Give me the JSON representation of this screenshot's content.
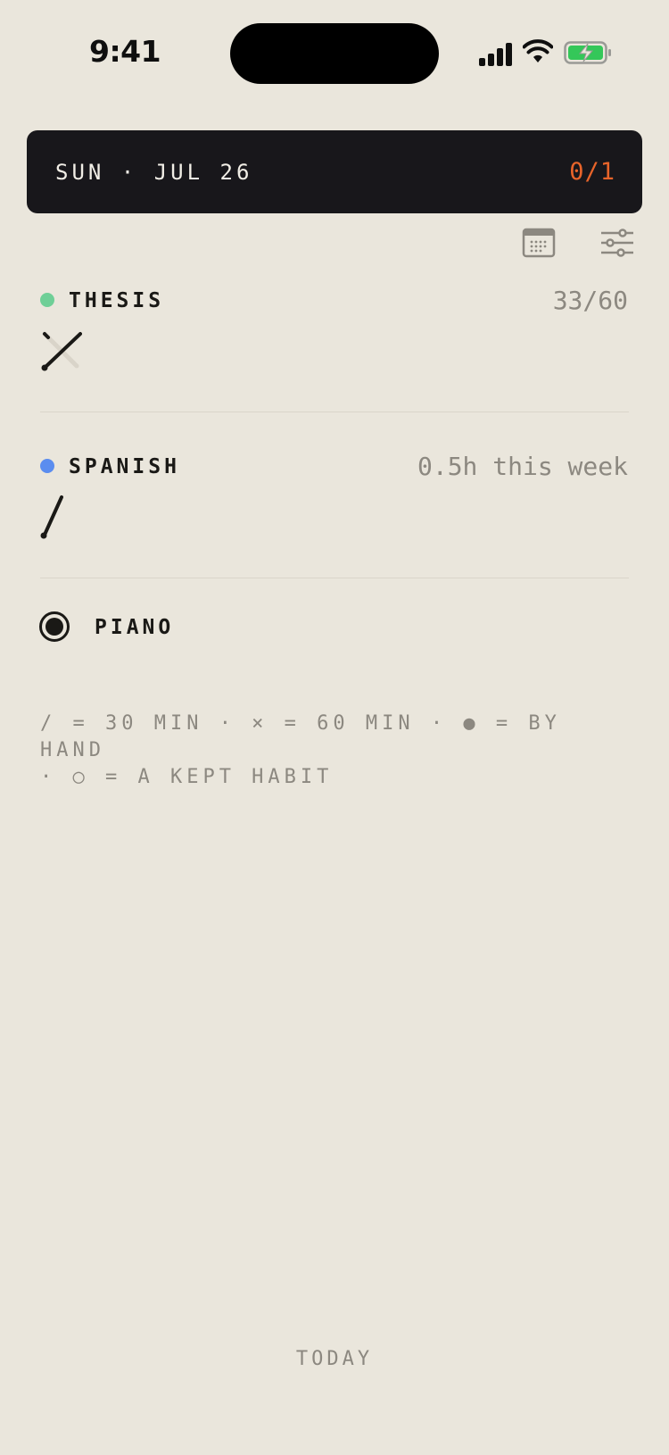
{
  "status_bar": {
    "time": "9:41"
  },
  "header": {
    "date": "SUN · JUL 26",
    "progress": "0/1",
    "progress_color": "#E8642A"
  },
  "toolbar": {
    "calendar_icon": "calendar-icon",
    "filter_icon": "sliders-icon"
  },
  "habits": [
    {
      "name": "THESIS",
      "color": "#6FCF97",
      "meta": "33/60",
      "mark": "×"
    },
    {
      "name": "SPANISH",
      "color": "#5B8DEF",
      "meta": "0.5h this week",
      "mark": "/"
    },
    {
      "name": "PIANO",
      "icon": "radio-target-icon"
    }
  ],
  "legend": {
    "line1": "/ = 30 MIN · × = 60 MIN · ● = BY HAND",
    "line2": "· ○ = A KEPT HABIT"
  },
  "bottom_nav": {
    "today_label": "TODAY"
  }
}
